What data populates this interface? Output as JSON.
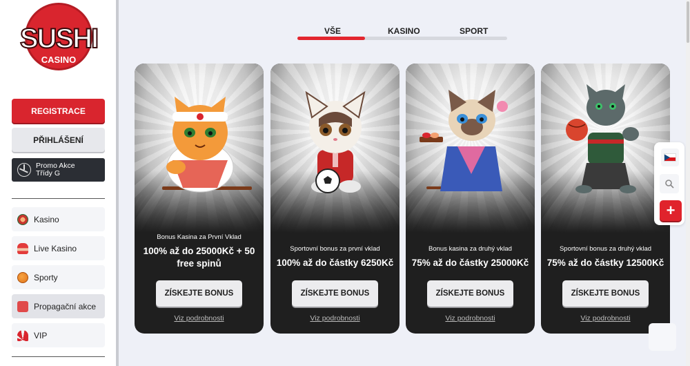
{
  "brand": {
    "name": "SUSHI",
    "sub": "CASINO",
    "color": "#d9252e"
  },
  "sidebar": {
    "register_label": "REGISTRACE",
    "login_label": "PŘIHLÁŠENÍ",
    "promo_card": {
      "line1": "Promo Akce",
      "line2": "Třídy G",
      "icon": "mercedes-icon"
    },
    "items": [
      {
        "label": "Kasino",
        "icon": "sushi-roll-icon"
      },
      {
        "label": "Live Kasino",
        "icon": "dealer-icon"
      },
      {
        "label": "Sporty",
        "icon": "basketball-icon"
      },
      {
        "label": "Propagační akce",
        "icon": "gift-icon",
        "active": true
      },
      {
        "label": "VIP",
        "icon": "fan-icon"
      }
    ]
  },
  "tabs": [
    {
      "label": "VŠE",
      "active": true
    },
    {
      "label": "KASINO"
    },
    {
      "label": "SPORT"
    }
  ],
  "cards": [
    {
      "label": "Bonus Kasina za První Vklad",
      "amount": "100% až do 25000Kč + 50 free spinů",
      "button": "ZÍSKEJTE BONUS",
      "link": "Viz podrobnosti",
      "mascot": "sushi-chef-cat"
    },
    {
      "label": "Sportovní bonus za první vklad",
      "amount": "100% až do částky 6250Kč",
      "button": "ZÍSKEJTE BONUS",
      "link": "Viz podrobnosti",
      "mascot": "football-cat"
    },
    {
      "label": "Bonus kasina za druhý vklad",
      "amount": "75% až do částky 25000Kč",
      "button": "ZÍSKEJTE BONUS",
      "link": "Viz podrobnosti",
      "mascot": "kimono-cat"
    },
    {
      "label": "Sportovní bonus za druhý vklad",
      "amount": "75% až do částky 12500Kč",
      "button": "ZÍSKEJTE BONUS",
      "link": "Viz podrobnosti",
      "mascot": "basketball-panther"
    }
  ],
  "float_panel": {
    "language": "czech-flag-icon",
    "search": "search-icon",
    "plus": "+"
  },
  "colors": {
    "accent": "#e3262f",
    "card_bg": "#1f1f1f",
    "page_bg": "#eef0f7"
  }
}
